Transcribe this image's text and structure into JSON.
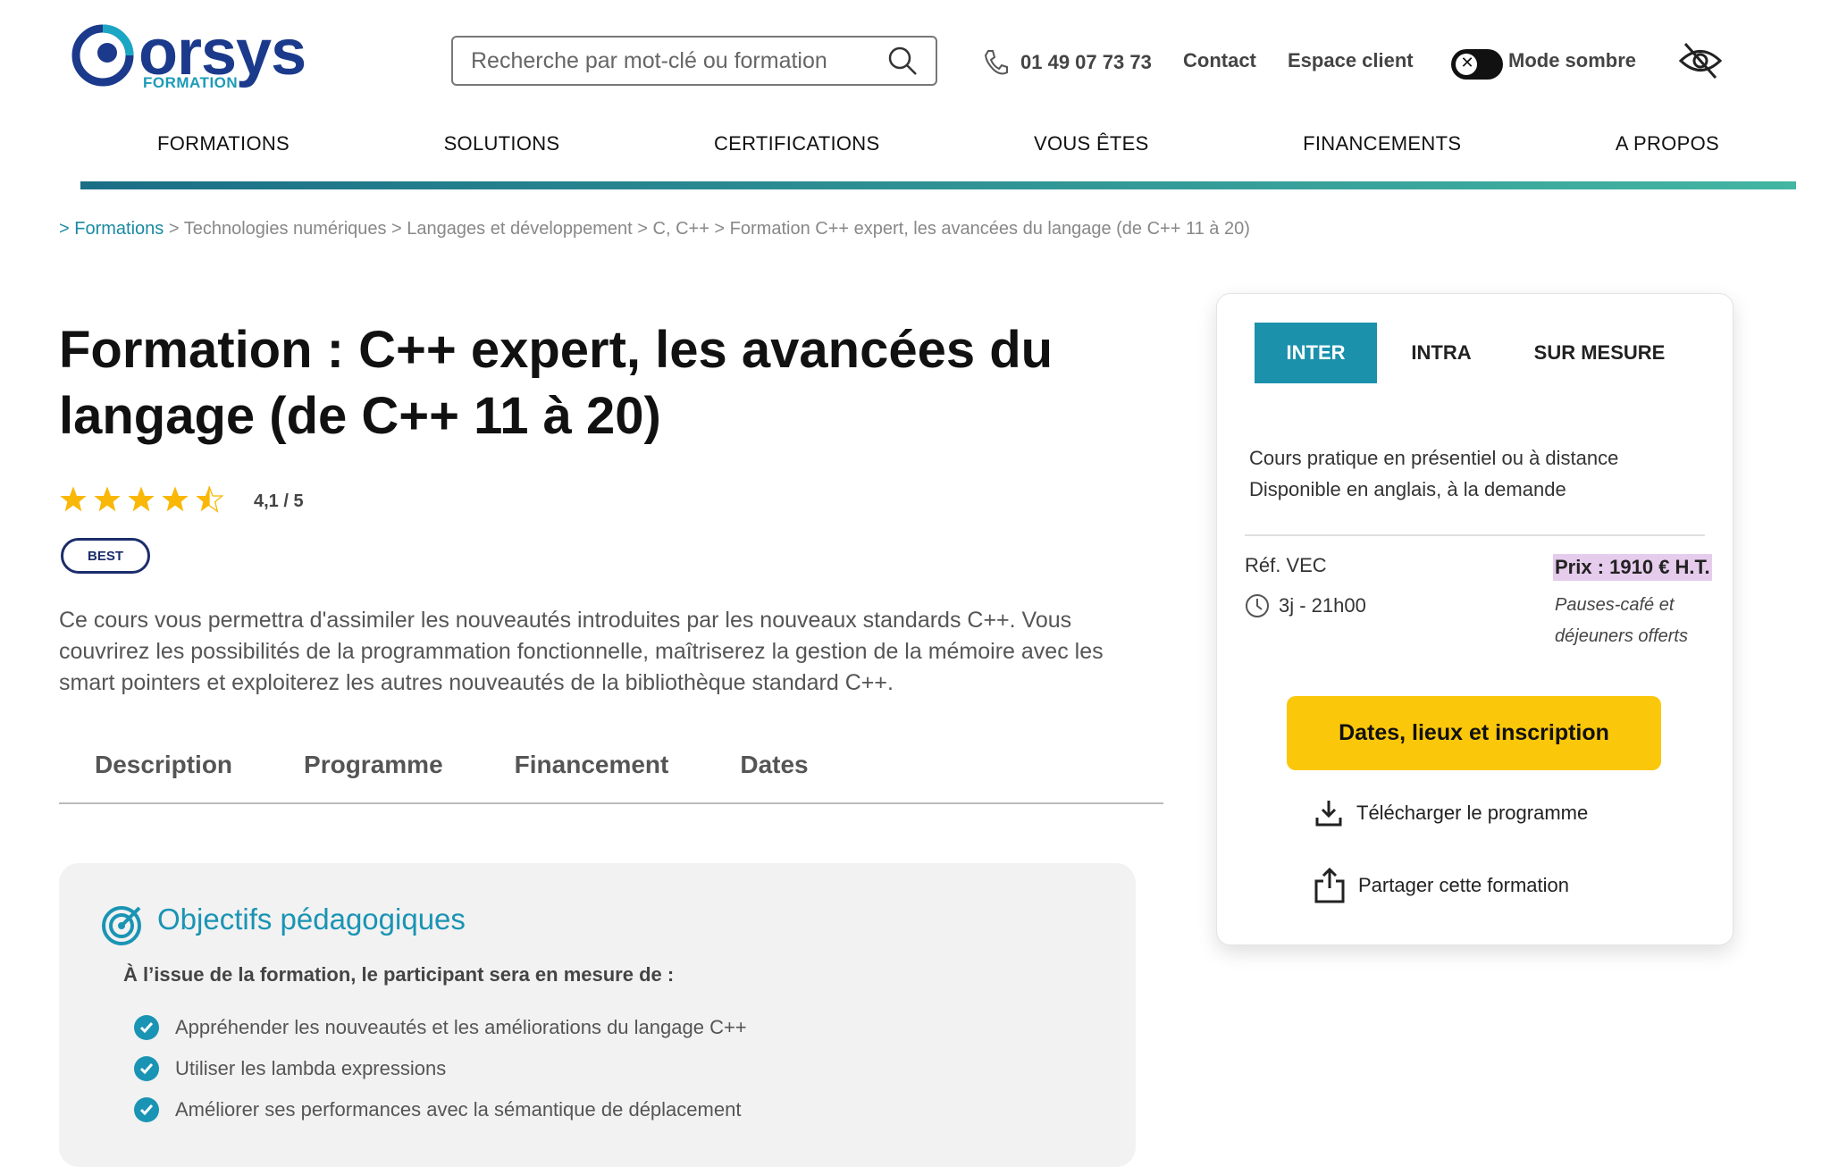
{
  "header": {
    "logo_text": "orsys",
    "logo_sub": "FORMATION",
    "search_placeholder": "Recherche par mot-clé ou formation",
    "phone": "01 49 07 73 73",
    "contact": "Contact",
    "client_space": "Espace client",
    "dark_mode": "Mode sombre"
  },
  "nav": [
    "FORMATIONS",
    "SOLUTIONS",
    "CERTIFICATIONS",
    "VOUS ÊTES",
    "FINANCEMENTS",
    "A PROPOS"
  ],
  "breadcrumb": {
    "first": "> Formations",
    "rest": " > Technologies numériques > Langages et développement > C, C++ > Formation C++ expert, les avancées du langage (de C++ 11 à 20)"
  },
  "course": {
    "title": "Formation : C++ expert, les avancées du langage (de C++ 11 à 20)",
    "rating_value": 4.1,
    "rating_text": "4,1 / 5",
    "badge": "BEST",
    "description": "Ce cours vous permettra d'assimiler les nouveautés introduites par les nouveaux standards C++. Vous couvrirez les possibilités de la programmation fonctionnelle, maîtriserez la gestion de la mémoire avec les smart pointers et exploiterez les autres nouveautés de la bibliothèque standard C++."
  },
  "tabs": [
    "Description",
    "Programme",
    "Financement",
    "Dates"
  ],
  "objectives": {
    "title": "Objectifs pédagogiques",
    "subtitle": "À l’issue de la formation, le participant sera en mesure de :",
    "items": [
      "Appréhender les nouveautés et les améliorations du langage C++",
      "Utiliser les lambda expressions",
      "Améliorer ses performances avec la sémantique de déplacement"
    ]
  },
  "card": {
    "tabs": [
      "INTER",
      "INTRA",
      "SUR MESURE"
    ],
    "info_line1": "Cours pratique en présentiel ou à distance",
    "info_line2": "Disponible en anglais, à la demande",
    "ref": "Réf. VEC",
    "duration": "3j - 21h00",
    "price": "Prix : 1910 € H.T.",
    "pause": "Pauses-café et déjeuners offerts",
    "cta": "Dates, lieux et inscription",
    "download": "Télécharger le programme",
    "share": "Partager cette formation"
  },
  "colors": {
    "brand": "#1b3a8c",
    "accent": "#1b91ac",
    "cta": "#fbc70a"
  }
}
